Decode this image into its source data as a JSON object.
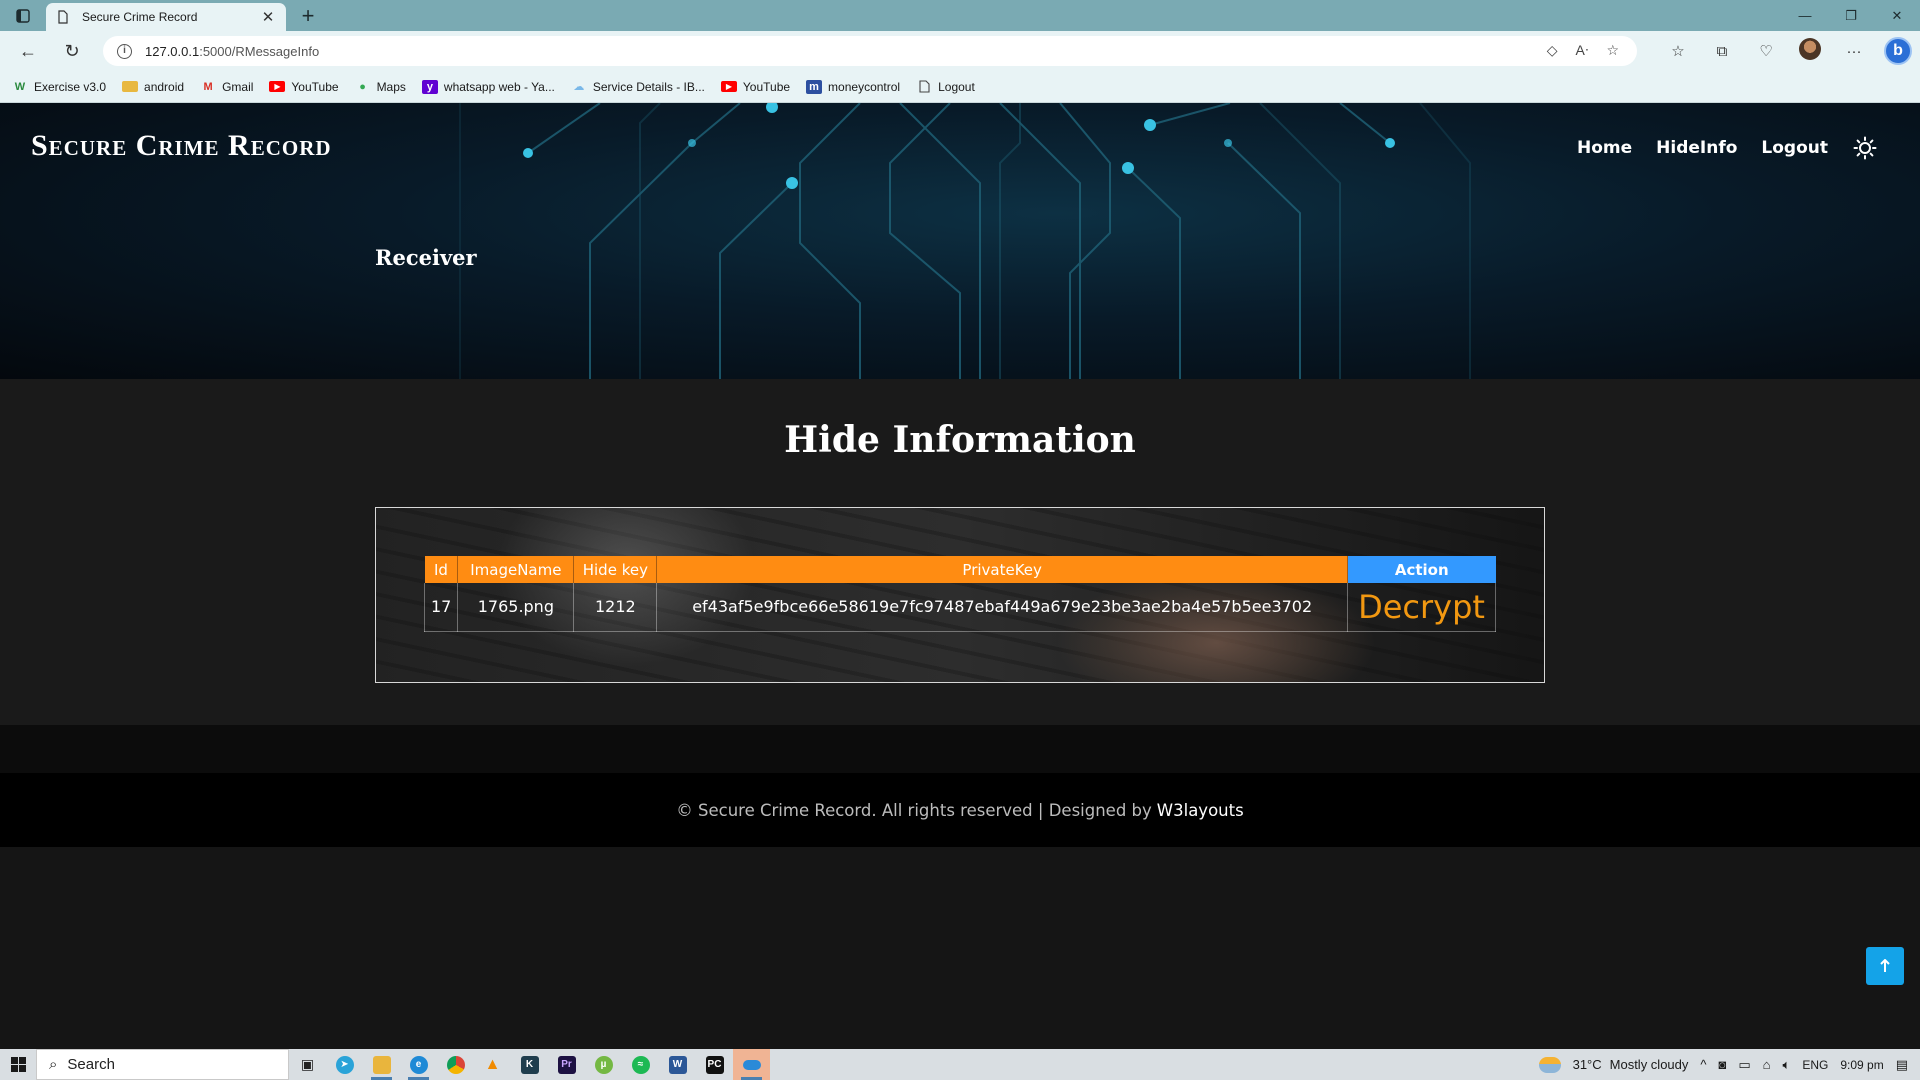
{
  "browser": {
    "tab_title": "Secure Crime Record",
    "url_host": "127.0.0.1",
    "url_rest": ":5000/RMessageInfo",
    "bookmarks": [
      {
        "label": "Exercise v3.0",
        "icon": "w-icon",
        "color": "#2a8a3e"
      },
      {
        "label": "android",
        "icon": "folder-icon",
        "color": "#e8b840"
      },
      {
        "label": "Gmail",
        "icon": "gmail-icon",
        "color": "#d93025"
      },
      {
        "label": "YouTube",
        "icon": "youtube-icon",
        "color": "#ff0000"
      },
      {
        "label": "Maps",
        "icon": "maps-pin-icon",
        "color": "#34a853"
      },
      {
        "label": "whatsapp web - Ya...",
        "icon": "yahoo-icon",
        "color": "#6001d2"
      },
      {
        "label": "Service Details - IB...",
        "icon": "cloud-icon",
        "color": "#7ab8e8"
      },
      {
        "label": "YouTube",
        "icon": "youtube-icon",
        "color": "#ff0000"
      },
      {
        "label": "moneycontrol",
        "icon": "moneycontrol-icon",
        "color": "#2c4fa0"
      },
      {
        "label": "Logout",
        "icon": "document-icon",
        "color": "#444444"
      }
    ]
  },
  "site": {
    "brand": "Secure Crime Record",
    "nav": [
      "Home",
      "HideInfo",
      "Logout"
    ],
    "breadcrumb": "Receiver",
    "section_title": "Hide Information",
    "table": {
      "headers": [
        "Id",
        "ImageName",
        "Hide key",
        "PrivateKey",
        "Action"
      ],
      "rows": [
        {
          "id": "17",
          "image_name": "1765.png",
          "hide_key": "1212",
          "private_key": "ef43af5e9fbce66e58619e7fc97487ebaf449a679e23be3ae2ba4e57b5ee3702",
          "action": "Decrypt"
        }
      ]
    },
    "footer": {
      "text": "© Secure Crime Record. All rights reserved | Designed by",
      "link": "W3layouts"
    },
    "colors": {
      "header_orange": "#ff8c12",
      "action_blue": "#3399ff",
      "decrypt_orange": "#f29811",
      "to_top": "#14a3e8"
    }
  },
  "taskbar": {
    "search_placeholder": "Search",
    "temperature": "31°C",
    "weather": "Mostly cloudy",
    "language": "ENG",
    "time": "9:09 pm"
  }
}
